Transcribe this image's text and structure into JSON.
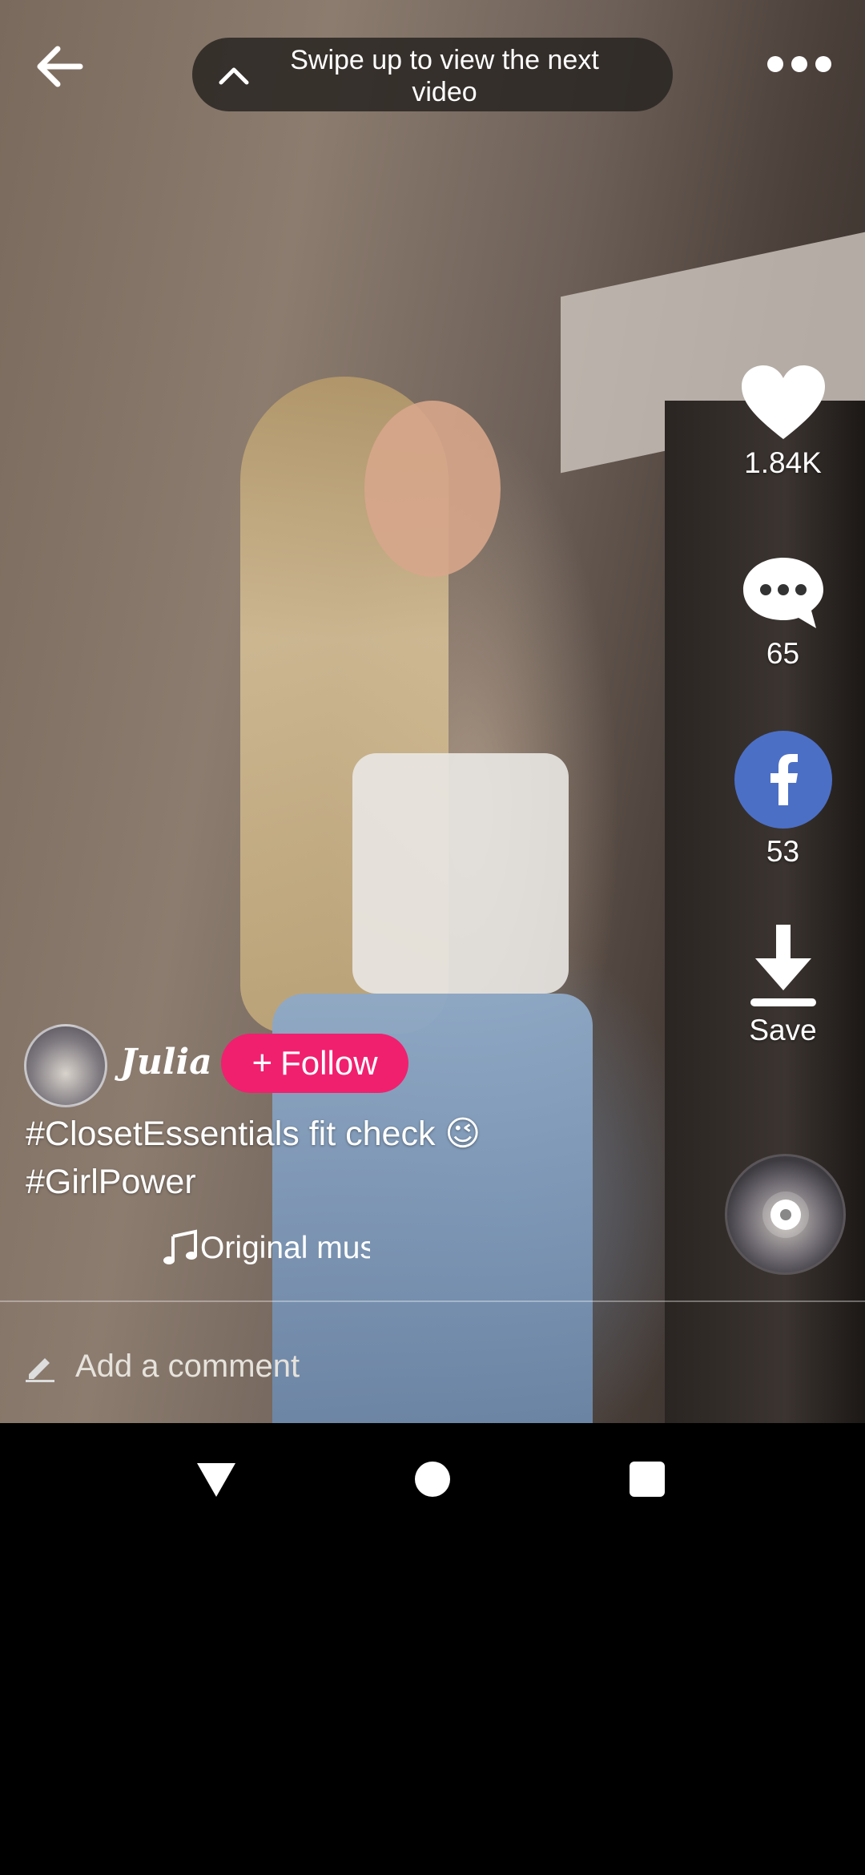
{
  "top_bar": {
    "swipe_hint": "Swipe up to view the next video"
  },
  "rail": {
    "likes": "1.84K",
    "comments": "65",
    "shares": "53",
    "save_label": "Save"
  },
  "author": {
    "name": "Julia",
    "follow_label": "Follow"
  },
  "post": {
    "caption_line1": "#ClosetEssentials  fit check 😉",
    "caption_line2": "#GirlPower",
    "music": "Original music"
  },
  "comment_bar": {
    "placeholder": "Add a comment"
  },
  "colors": {
    "follow": "#f0206f",
    "facebook": "#4c6fc6"
  },
  "icons": [
    "back-arrow-icon",
    "chevron-up-icon",
    "more-icon",
    "heart-icon",
    "comment-icon",
    "facebook-icon",
    "download-icon",
    "music-note-icon",
    "pencil-icon"
  ]
}
